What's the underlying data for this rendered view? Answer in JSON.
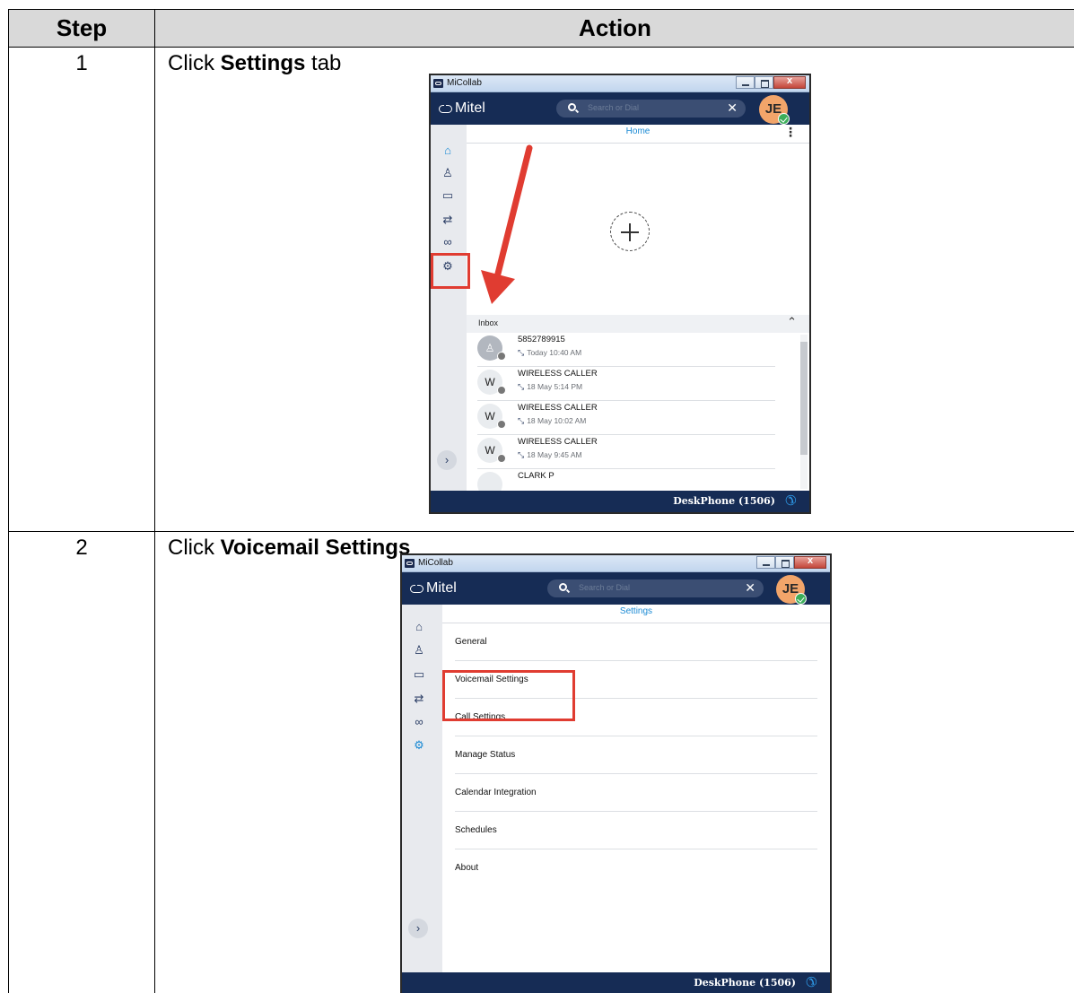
{
  "table": {
    "header_step": "Step",
    "header_action": "Action"
  },
  "steps": [
    {
      "number": "1",
      "instruction_pre": "Click ",
      "instruction_bold": "Settings",
      "instruction_post": " tab",
      "window": {
        "title": "MiCollab",
        "logo": "Mitel",
        "search_placeholder": "Search or Dial",
        "avatar_initials": "JE",
        "page_title": "Home",
        "inbox_label": "Inbox",
        "inbox_items": [
          {
            "name": "5852789915",
            "time": "Today 10:40 AM",
            "avatar": ""
          },
          {
            "name": "WIRELESS CALLER",
            "time": "18 May 5:14 PM",
            "avatar": "W"
          },
          {
            "name": "WIRELESS CALLER",
            "time": "18 May 10:02 AM",
            "avatar": "W"
          },
          {
            "name": "WIRELESS CALLER",
            "time": "18 May 9:45 AM",
            "avatar": "W"
          },
          {
            "name": "CLARK P",
            "time": "",
            "avatar": ""
          }
        ],
        "footer_label": "DeskPhone (1506)"
      }
    },
    {
      "number": "2",
      "instruction_pre": "Click ",
      "instruction_bold": "Voicemail Settings",
      "instruction_post": "",
      "window": {
        "title": "MiCollab",
        "logo": "Mitel",
        "search_placeholder": "Search or Dial",
        "avatar_initials": "JE",
        "page_title": "Settings",
        "settings_items": [
          "General",
          "Voicemail Settings",
          "Call Settings",
          "Manage Status",
          "Calendar Integration",
          "Schedules",
          "About"
        ],
        "footer_label": "DeskPhone (1506)"
      }
    }
  ],
  "icons": {
    "sidebar": [
      "home-icon",
      "contacts-icon",
      "chat-icon",
      "call-history-icon",
      "voicemail-icon",
      "settings-icon"
    ],
    "highlight_color": "#e03c31",
    "brand_navy": "#162c55",
    "accent_blue": "#1b8ad4"
  }
}
